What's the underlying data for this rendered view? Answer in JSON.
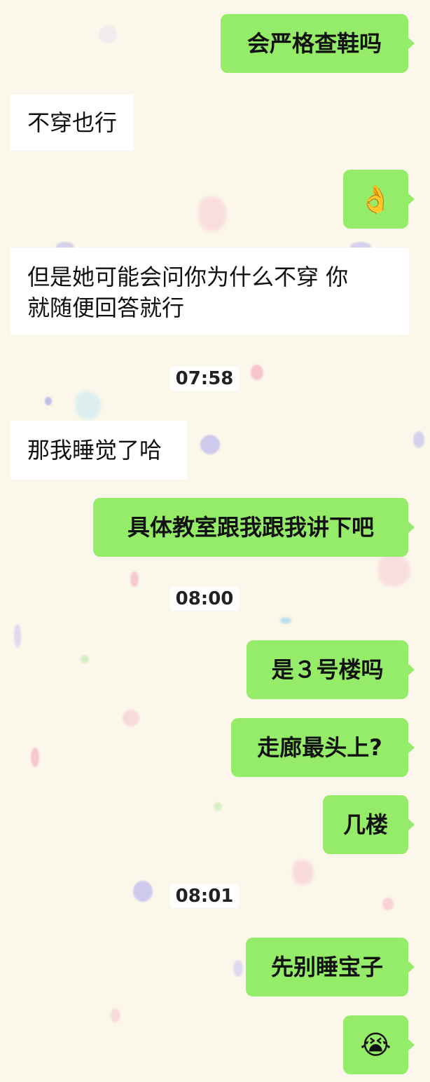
{
  "conversation": {
    "messages": [
      {
        "text": "会严格查鞋吗"
      },
      {
        "text": "不穿也行"
      },
      {
        "emoji": "👌"
      },
      {
        "line1": "但是她可能会问你为什么不穿 你",
        "line2": "就随便回答就行"
      },
      {
        "timestamp": "07:58"
      },
      {
        "text": "那我睡觉了哈"
      },
      {
        "text": "具体教室跟我跟我讲下吧"
      },
      {
        "timestamp": "08:00"
      },
      {
        "text": "是３号楼吗"
      },
      {
        "text": "走廊最头上?"
      },
      {
        "text": "几楼"
      },
      {
        "timestamp": "08:01"
      },
      {
        "text": "先别睡宝子"
      },
      {
        "emoji": "😭"
      }
    ]
  },
  "theme": {
    "outgoing_bubble": "#95ec69",
    "incoming_bubble": "#ffffff",
    "background": "#fbf7ea"
  }
}
